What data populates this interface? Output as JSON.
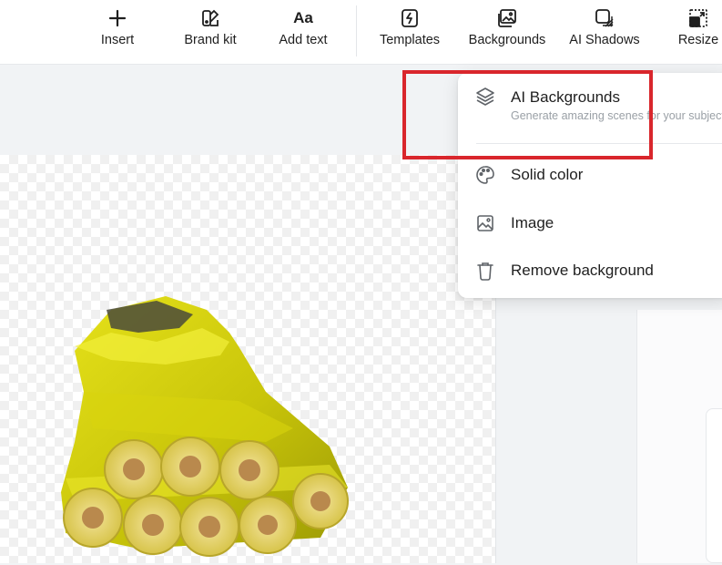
{
  "toolbar": {
    "items": [
      {
        "label": "Insert",
        "icon": "plus-icon"
      },
      {
        "label": "Brand kit",
        "icon": "brand-kit-icon"
      },
      {
        "label": "Add text",
        "icon": "text-icon",
        "glyph": "Aa"
      },
      {
        "label": "Templates",
        "icon": "templates-icon"
      },
      {
        "label": "Backgrounds",
        "icon": "backgrounds-icon"
      },
      {
        "label": "AI Shadows",
        "icon": "shadow-icon"
      },
      {
        "label": "Resize",
        "icon": "resize-icon"
      }
    ]
  },
  "backgrounds_menu": {
    "ai_backgrounds": {
      "label": "AI Backgrounds",
      "subtitle": "Generate amazing scenes for your subject",
      "icon": "layers-icon"
    },
    "items": [
      {
        "label": "Solid color",
        "icon": "palette-icon"
      },
      {
        "label": "Image",
        "icon": "image-icon"
      },
      {
        "label": "Remove background",
        "icon": "trash-icon"
      }
    ]
  },
  "colors": {
    "highlight": "#d9262c",
    "toolbar_bg": "#ffffff",
    "canvas_bg": "#f1f3f5"
  }
}
